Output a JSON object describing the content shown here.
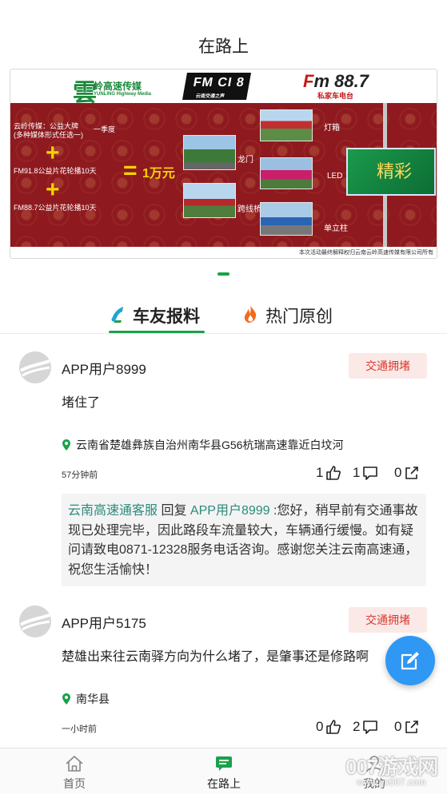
{
  "header": {
    "title": "在路上"
  },
  "banner": {
    "logo_left_glyph": "雲",
    "logo_left_title": "岭高速传媒",
    "logo_left_sub": "YUNLING Highway Media",
    "logo_mid_title": "FM CI 8",
    "logo_mid_sub": "云南交通之声",
    "logo_right_title_f": "F",
    "logo_right_title_rest": "m 88.7",
    "logo_right_sub": "私家车电台",
    "promo_line1": "云岭传媒：公益大牌",
    "promo_line2": "(多种媒体形式任选一)",
    "promo_line2_suffix": "一季度",
    "promo_line3": "FM91.8公益片花轮播10天",
    "promo_line4": "FM88.7公益片花轮播10天",
    "plus_sign": "+",
    "equals_sign": "=",
    "price": "1万元",
    "label_gantry": "龙门",
    "label_bridge": "跨线桥",
    "label_lightbox": "灯箱",
    "label_led": "LED",
    "label_pillar": "单立柱",
    "board_text": "精彩",
    "footnote": "本次活动最终解释权归云南云岭高速传媒有限公司所有"
  },
  "tabs": [
    {
      "label": "车友报料",
      "active": true
    },
    {
      "label": "热门原创",
      "active": false
    }
  ],
  "posts": [
    {
      "username": "APP用户8999",
      "tag": "交通拥堵",
      "content": "堵住了",
      "location": "云南省楚雄彝族自治州南华县G56杭瑞高速靠近白坟河",
      "time": "57分钟前",
      "likes": "1",
      "comments": "1",
      "shares": "0",
      "reply": {
        "author": "云南高速通客服",
        "verb": " 回复 ",
        "target": "APP用户8999",
        "text": " :您好，稍早前有交通事故现已处理完毕，因此路段车流量较大，车辆通行缓慢。如有疑问请致电0871-12328服务电话咨询。感谢您关注云南高速通，祝您生活愉快！"
      }
    },
    {
      "username": "APP用户5175",
      "tag": "交通拥堵",
      "content": "楚雄出来往云南驿方向为什么堵了，是肇事还是修路啊",
      "location": "南华县",
      "time": "一小时前",
      "likes": "0",
      "comments": "2",
      "shares": "0"
    }
  ],
  "bottom_nav": [
    {
      "label": "首页",
      "icon": "home-icon"
    },
    {
      "label": "在路上",
      "icon": "chat-icon",
      "active": true
    },
    {
      "label": "我的",
      "icon": "user-icon"
    }
  ],
  "watermark": {
    "big": "007游戏网",
    "small": "www.yx007.com"
  },
  "colors": {
    "accent": "#1aa24a",
    "tag_bg": "#fbe9e7",
    "tag_text": "#d93a2f",
    "fab": "#2f97f4",
    "reply_author": "#2a8a7c"
  }
}
